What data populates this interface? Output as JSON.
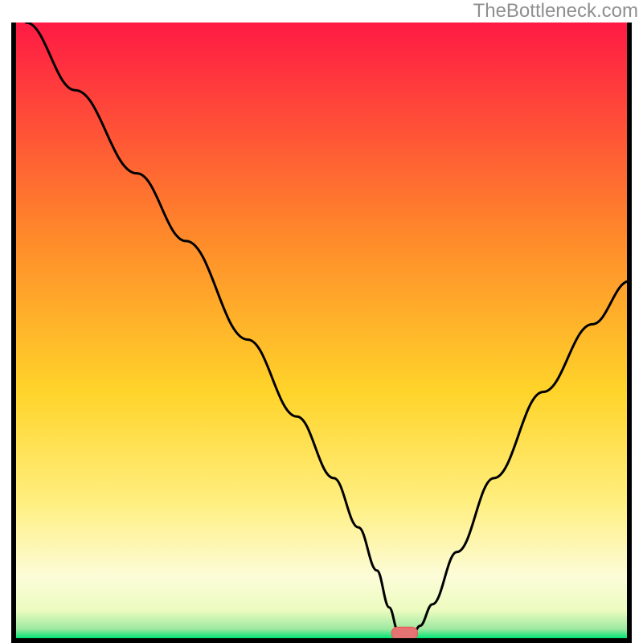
{
  "watermark": "TheBottleneck.com",
  "colors": {
    "border": "#000000",
    "gradient_top": "#ff1a44",
    "gradient_mid_high": "#ff8a2a",
    "gradient_mid": "#ffd42a",
    "gradient_lowish": "#ffef80",
    "gradient_pale": "#fcfccc",
    "gradient_green": "#00e676",
    "curve": "#000000",
    "curve_tip_fill": "#e57373",
    "curve_tip_stroke": "#ef5350"
  },
  "chart_data": {
    "type": "line",
    "title": "",
    "xlabel": "",
    "ylabel": "",
    "xlim": [
      0,
      100
    ],
    "ylim": [
      0,
      100
    ],
    "note": "No axis ticks or scale labels are rendered in the image. X and Y are expressed as 0–100 percent of the plot interior. Y is the vertical position measured from the bottom (0) to the top (100) of the interior. The curve is a single black line descending steeply from top-left, reaching ~0 near x≈62–66 (marked with a small red rounded pill on the x-axis), then rising toward the right.",
    "series": [
      {
        "name": "curve",
        "x": [
          2.0,
          10.0,
          20.0,
          28.0,
          38.0,
          46.0,
          52.0,
          56.0,
          59.0,
          61.0,
          62.5,
          65.0,
          66.0,
          68.0,
          72.0,
          78.0,
          86.0,
          94.0,
          100.0
        ],
        "y": [
          100.0,
          89.0,
          75.5,
          64.5,
          48.5,
          36.0,
          26.0,
          18.0,
          11.0,
          5.0,
          1.0,
          1.0,
          2.0,
          5.5,
          14.0,
          26.0,
          40.0,
          51.0,
          58.0
        ]
      }
    ],
    "marker": {
      "name": "minimum",
      "x_center": 63.5,
      "y": 0.8,
      "width_pct": 4.2,
      "height_pct": 2.0
    },
    "background_gradient": [
      {
        "stop": 0.0,
        "color": "#ff1a44"
      },
      {
        "stop": 0.35,
        "color": "#ff8a2a"
      },
      {
        "stop": 0.6,
        "color": "#ffd42a"
      },
      {
        "stop": 0.78,
        "color": "#ffef80"
      },
      {
        "stop": 0.9,
        "color": "#fcfcd8"
      },
      {
        "stop": 0.955,
        "color": "#ecfcc0"
      },
      {
        "stop": 0.985,
        "color": "#9de8a0"
      },
      {
        "stop": 1.0,
        "color": "#00e676"
      }
    ]
  }
}
